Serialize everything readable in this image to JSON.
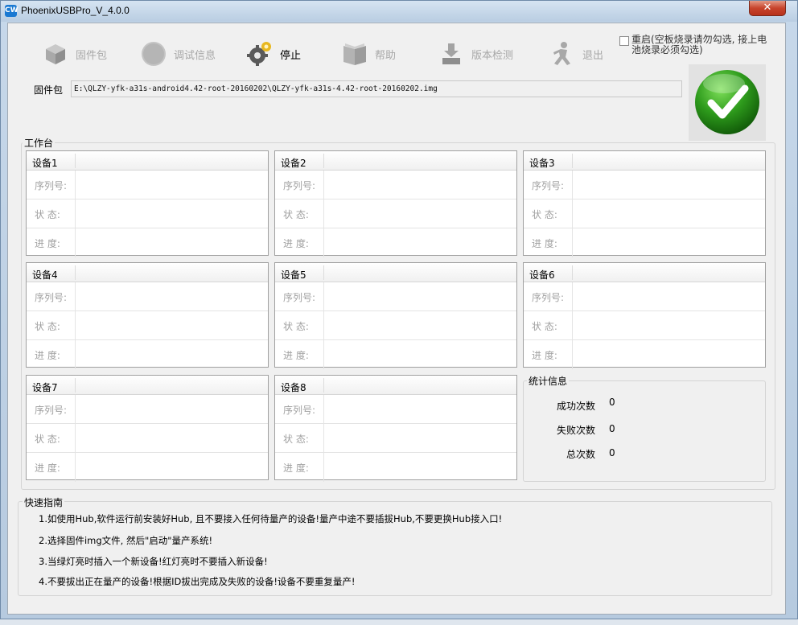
{
  "window": {
    "title": "PhoenixUSBPro_V_4.0.0",
    "app_icon_text": "CW",
    "close_symbol": "✕"
  },
  "toolbar": {
    "firmware": "固件包",
    "debug": "调试信息",
    "stop": "停止",
    "help": "帮助",
    "version": "版本检测",
    "exit": "退出",
    "restart_checkbox": "重启(空板烧录请勿勾选, 接上电池烧录必须勾选)"
  },
  "firmware": {
    "label": "固件包",
    "path": "E:\\QLZY-yfk-a31s-android4.42-root-20160202\\QLZY-yfk-a31s-4.42-root-20160202.img"
  },
  "workbench": {
    "title": "工作台",
    "field_labels": {
      "serial": "序列号:",
      "status": "状  态:",
      "progress": "进  度:"
    },
    "devices": [
      {
        "name": "设备1"
      },
      {
        "name": "设备2"
      },
      {
        "name": "设备3"
      },
      {
        "name": "设备4"
      },
      {
        "name": "设备5"
      },
      {
        "name": "设备6"
      },
      {
        "name": "设备7"
      },
      {
        "name": "设备8"
      }
    ]
  },
  "stats": {
    "title": "统计信息",
    "success_label": "成功次数",
    "success_value": "0",
    "fail_label": "失败次数",
    "fail_value": "0",
    "total_label": "总次数",
    "total_value": "0"
  },
  "guide": {
    "title": "快速指南",
    "items": [
      "1.如使用Hub,软件运行前安装好Hub, 且不要接入任何待量产的设备!量产中途不要插拔Hub,不要更换Hub接入口!",
      "2.选择固件img文件, 然后\"启动\"量产系统!",
      "3.当绿灯亮时插入一个新设备!红灯亮时不要插入新设备!",
      "4.不要拔出正在量产的设备!根据ID拔出完成及失败的设备!设备不要重复量产!"
    ]
  },
  "colors": {
    "ok_green": "#2e9b1c",
    "disabled_text": "#a8a8a8"
  }
}
